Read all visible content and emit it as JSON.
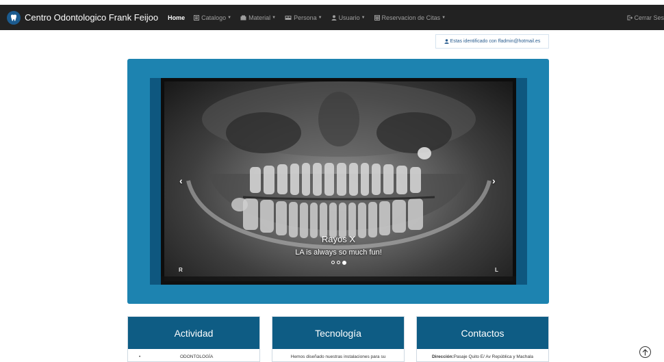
{
  "navbar": {
    "brand": "Centro Odontologico Frank Feijoo",
    "items": [
      {
        "label": "Home",
        "icon": ""
      },
      {
        "label": "Catalogo",
        "icon": "list-icon"
      },
      {
        "label": "Material",
        "icon": "box-icon"
      },
      {
        "label": "Persona",
        "icon": "people-icon"
      },
      {
        "label": "Usuario",
        "icon": "user-icon"
      },
      {
        "label": "Reservacion de Citas",
        "icon": "calendar-icon"
      }
    ],
    "logout": "Cerrar Ses"
  },
  "identity": {
    "text": "Estas identificado con ffadmin@hotmail.es"
  },
  "carousel": {
    "title": "Rayos X",
    "subtitle": "LA is always so much fun!",
    "slides_count": 3,
    "active_slide": 3,
    "mark_left": "R",
    "mark_right": "L",
    "prev": "‹",
    "next": "›"
  },
  "cards": [
    {
      "title": "Actividad",
      "body": "ODONTOLOGÍA",
      "bullet": "•"
    },
    {
      "title": "Tecnología",
      "body": "Hemos diseñado nuestras instalaciones para su"
    },
    {
      "title": "Contactos",
      "label": "Dirección:",
      "body": "Pasaje Quito E/ Av República y Machala"
    }
  ],
  "colors": {
    "navbar": "#222222",
    "panel": "#1d83b0",
    "card_header": "#0e5c84"
  }
}
